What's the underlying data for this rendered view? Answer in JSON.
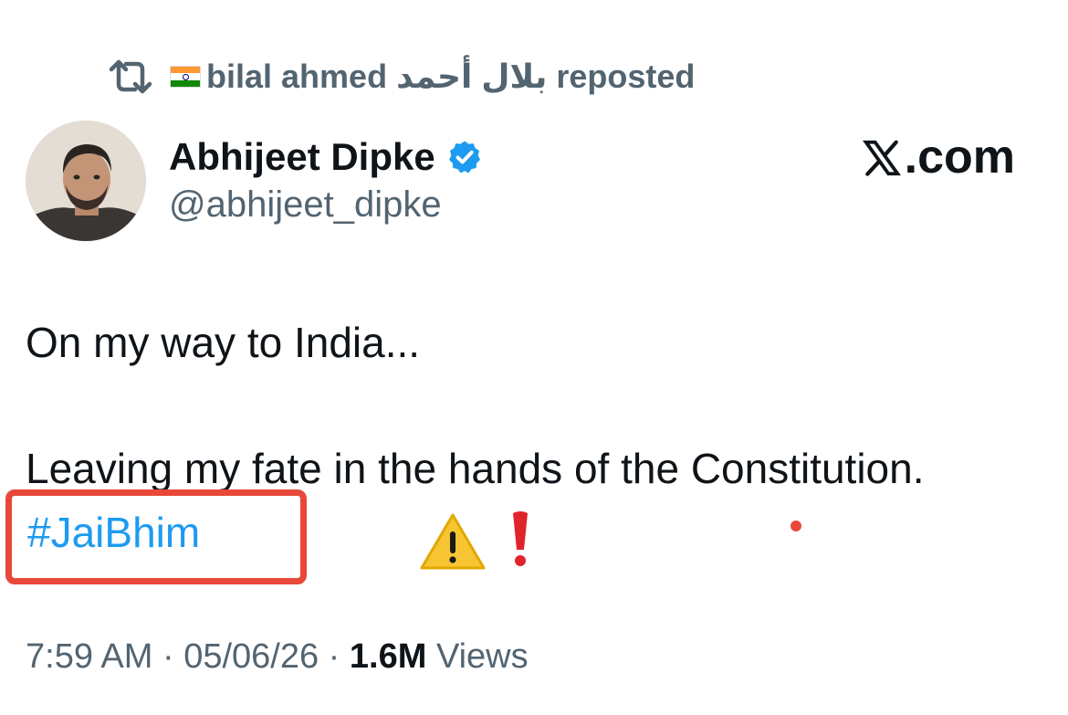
{
  "repost": {
    "flag_icon": "india-flag-icon",
    "user_name": "bilal ahmed بلال أحمد",
    "suffix": "reposted"
  },
  "author": {
    "name": "Abhijeet Dipke",
    "handle": "@abhijeet_dipke",
    "verified": true
  },
  "watermark": {
    "text": ".com"
  },
  "tweet": {
    "line1": "On my way to India...",
    "line2": "Leaving my fate in the hands of the Constitution.",
    "hashtag": "#JaiBhim",
    "emojis": [
      "warning-icon",
      "exclamation-icon"
    ]
  },
  "meta": {
    "time": "7:59 AM",
    "separator": " · ",
    "date": "05/06/26",
    "views_count": "1.6M",
    "views_label": " Views"
  },
  "colors": {
    "link": "#1d9bf0",
    "secondary_text": "#536471",
    "primary_text": "#0f1419",
    "verified": "#1d9bf0",
    "highlight": "#e8483a"
  }
}
